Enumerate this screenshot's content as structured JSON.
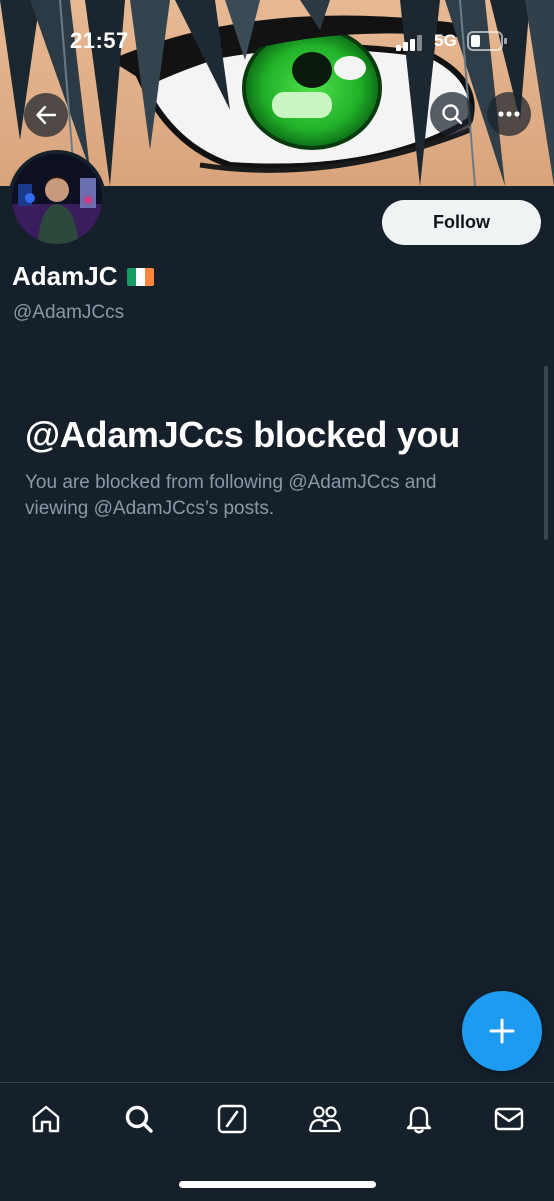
{
  "status_bar": {
    "time": "21:57",
    "network": "5G"
  },
  "profile": {
    "display_name": "AdamJC",
    "flag": "Ireland flag",
    "handle": "@AdamJCcs",
    "follow_label": "Follow"
  },
  "blocked": {
    "title": "@AdamJCcs blocked you",
    "description": "You are blocked from following @AdamJCcs and viewing @AdamJCcs’s posts."
  },
  "icons": {
    "back": "arrow-left-icon",
    "search": "search-icon",
    "more": "more-horizontal-icon",
    "compose": "plus-icon",
    "tabs": [
      "home-icon",
      "search-icon",
      "grok-icon",
      "communities-icon",
      "notifications-icon",
      "messages-icon"
    ]
  },
  "colors": {
    "background": "#15202b",
    "accent": "#1d9bf0",
    "secondary_text": "#8b98a5",
    "follow_button": "#eff3f4"
  }
}
